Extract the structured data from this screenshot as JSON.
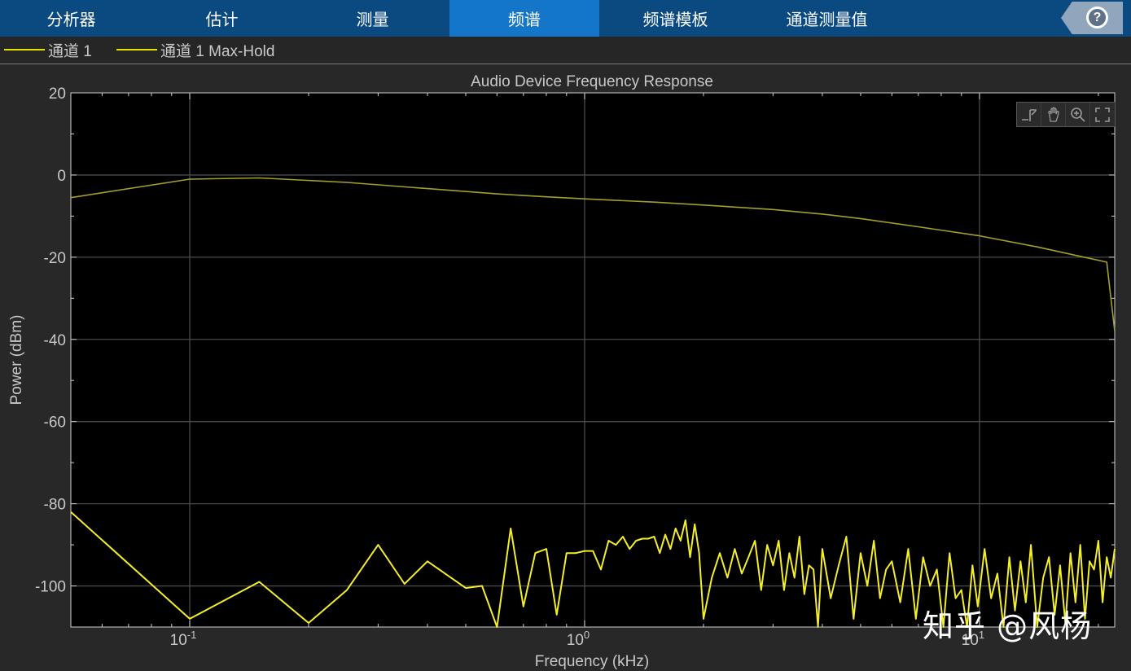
{
  "toolstrip": {
    "tabs": [
      {
        "label": "分析器",
        "active": false
      },
      {
        "label": "估计",
        "active": false
      },
      {
        "label": "测量",
        "active": false
      },
      {
        "label": "频谱",
        "active": true
      },
      {
        "label": "频谱模板",
        "active": false
      },
      {
        "label": "通道测量值",
        "active": false
      }
    ],
    "help_label": "?"
  },
  "legend": {
    "items": [
      "通道 1",
      "通道 1 Max-Hold"
    ]
  },
  "watermark": "知乎 @风杨",
  "colors": {
    "toolstrip_bg": "#0b4a80",
    "active_tab": "#1476c8",
    "trace": "#e8e100",
    "background": "#282828",
    "plot_bg": "#000000"
  },
  "plot_tools": [
    "data-cursor-icon",
    "pan-icon",
    "zoom-in-icon",
    "autoscale-icon"
  ],
  "chart_data": {
    "type": "line",
    "title": "Audio Device Frequency Response",
    "xlabel": "Frequency (kHz)",
    "ylabel": "Power (dBm)",
    "xscale": "log",
    "xlim": [
      0.05,
      22
    ],
    "ylim": [
      -110,
      20
    ],
    "yticks": [
      20,
      0,
      -20,
      -40,
      -60,
      -80,
      -100
    ],
    "xticks": [
      {
        "value": 0.1,
        "base": "10",
        "exp": "-1"
      },
      {
        "value": 1,
        "base": "10",
        "exp": "0"
      },
      {
        "value": 10,
        "base": "10",
        "exp": "1"
      }
    ],
    "grid": true,
    "legend_position": "top-left",
    "series": [
      {
        "name": "通道 1 Max-Hold",
        "x": [
          0.05,
          0.1,
          0.15,
          0.25,
          0.4,
          0.6,
          0.8,
          1.0,
          1.5,
          2.0,
          3.0,
          4.0,
          5.0,
          7.0,
          10.0,
          14.0,
          18.0,
          21.0,
          22.0
        ],
        "y": [
          -5.5,
          -1.0,
          -0.7,
          -1.8,
          -3.3,
          -4.6,
          -5.3,
          -5.8,
          -6.6,
          -7.3,
          -8.4,
          -9.5,
          -10.6,
          -12.6,
          -14.8,
          -17.5,
          -19.8,
          -21.2,
          -38
        ]
      },
      {
        "name": "通道 1",
        "x": [
          0.05,
          0.1,
          0.15,
          0.2,
          0.25,
          0.3,
          0.35,
          0.4,
          0.5,
          0.55,
          0.6,
          0.65,
          0.7,
          0.75,
          0.8,
          0.85,
          0.9,
          0.95,
          1.0,
          1.05,
          1.1,
          1.15,
          1.2,
          1.25,
          1.3,
          1.35,
          1.4,
          1.45,
          1.5,
          1.55,
          1.6,
          1.65,
          1.7,
          1.75,
          1.8,
          1.85,
          1.9,
          1.95,
          2.0,
          2.1,
          2.2,
          2.3,
          2.4,
          2.5,
          2.6,
          2.7,
          2.8,
          2.9,
          3.0,
          3.1,
          3.2,
          3.3,
          3.4,
          3.5,
          3.6,
          3.7,
          3.8,
          3.9,
          4.0,
          4.2,
          4.4,
          4.6,
          4.8,
          5.0,
          5.2,
          5.4,
          5.6,
          5.8,
          6.0,
          6.3,
          6.6,
          6.9,
          7.2,
          7.5,
          7.8,
          8.1,
          8.4,
          8.7,
          9.0,
          9.3,
          9.6,
          9.9,
          10.3,
          10.7,
          11.1,
          11.5,
          11.9,
          12.3,
          12.7,
          13.1,
          13.5,
          14.0,
          14.5,
          15.0,
          15.5,
          16.0,
          16.5,
          17.0,
          17.5,
          18.0,
          18.5,
          19.0,
          19.5,
          20.0,
          20.5,
          21.0,
          21.5,
          22.0
        ],
        "y": [
          -82,
          -108,
          -99,
          -109,
          -101,
          -90,
          -99.5,
          -94,
          -100.5,
          -100,
          -110,
          -86,
          -105,
          -92,
          -91,
          -107,
          -92,
          -92,
          -91.5,
          -91.5,
          -96,
          -89,
          -90,
          -88,
          -91,
          -89,
          -88.5,
          -88.5,
          -88,
          -92,
          -87.5,
          -91,
          -86,
          -89,
          -84,
          -93,
          -85,
          -92,
          -108,
          -98,
          -92,
          -98,
          -91,
          -97,
          -93,
          -89,
          -101,
          -90,
          -95,
          -89,
          -101,
          -92,
          -98,
          -88,
          -102,
          -95,
          -96,
          -110,
          -91,
          -103,
          -95,
          -88,
          -108,
          -92,
          -100,
          -89,
          -103,
          -96,
          -94,
          -104,
          -91,
          -108,
          -93,
          -100,
          -96,
          -110,
          -92,
          -103,
          -101,
          -110,
          -95,
          -105,
          -91,
          -103,
          -97,
          -110,
          -93,
          -106,
          -94,
          -104,
          -90,
          -110,
          -98,
          -93,
          -107,
          -95,
          -109,
          -92,
          -104,
          -90,
          -108,
          -94,
          -96,
          -89,
          -104,
          -93,
          -98,
          -91
        ]
      }
    ]
  }
}
